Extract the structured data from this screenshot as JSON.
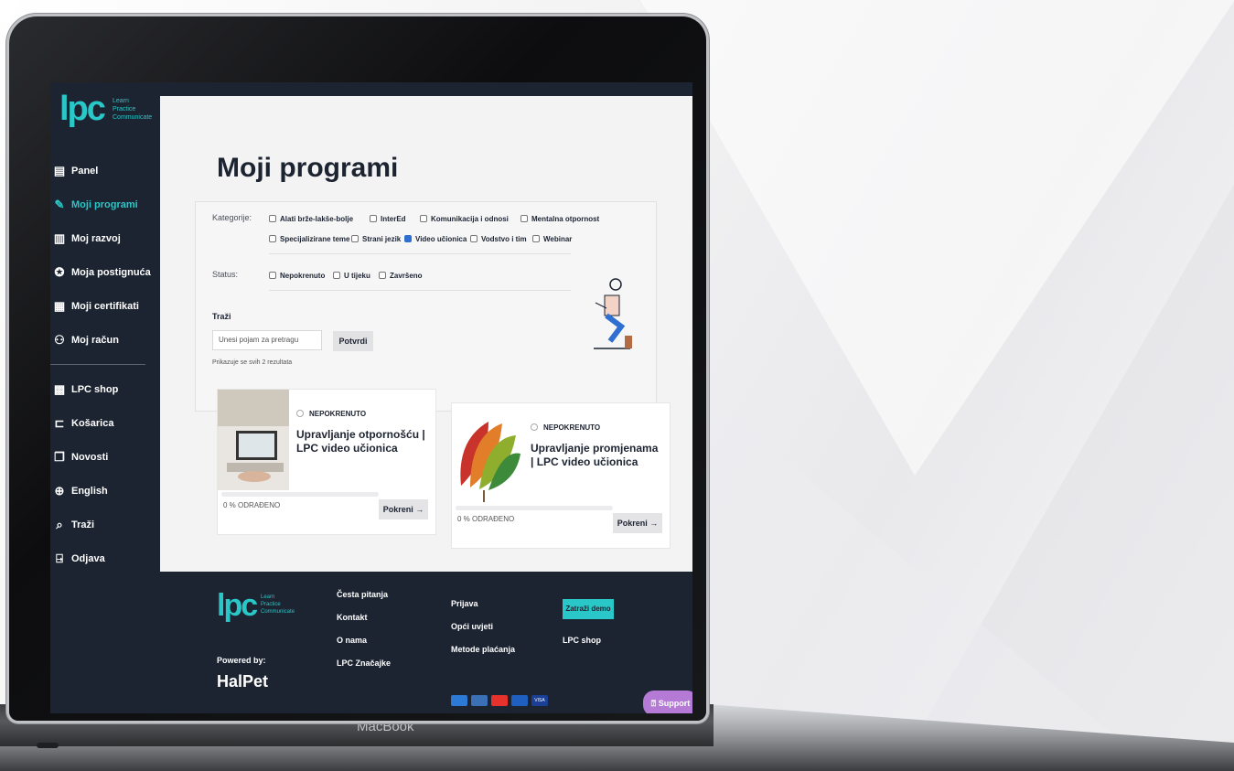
{
  "app": {
    "logo_mark": "lpc",
    "logo_tagline": [
      "Learn",
      "Practice",
      "Communicate"
    ]
  },
  "sidebar": {
    "items": [
      {
        "label": "Panel",
        "icon": "book-icon",
        "glyph": "▤"
      },
      {
        "label": "Moji programi",
        "icon": "edit-book-icon",
        "glyph": "✎"
      },
      {
        "label": "Moj razvoj",
        "icon": "document-icon",
        "glyph": "▥"
      },
      {
        "label": "Moja postignuća",
        "icon": "medal-icon",
        "glyph": "✪"
      },
      {
        "label": "Moji certifikati",
        "icon": "certificate-icon",
        "glyph": "▦"
      },
      {
        "label": "Moj račun",
        "icon": "user-icon",
        "glyph": "⚇"
      }
    ],
    "items2": [
      {
        "label": "LPC shop",
        "icon": "store-icon",
        "glyph": "▩"
      },
      {
        "label": "Košarica",
        "icon": "cart-icon",
        "glyph": "⊏"
      },
      {
        "label": "Novosti",
        "icon": "news-icon",
        "glyph": "❐"
      },
      {
        "label": "English",
        "icon": "globe-icon",
        "glyph": "⊕"
      },
      {
        "label": "Traži",
        "icon": "search-icon",
        "glyph": "⌕"
      },
      {
        "label": "Odjava",
        "icon": "logout-icon",
        "glyph": "⍈"
      }
    ],
    "active_index": 1
  },
  "main": {
    "title": "Moji programi",
    "filters": {
      "categories_label": "Kategorije:",
      "categories": [
        {
          "label": "Alati brže-lakše-bolje",
          "checked": false
        },
        {
          "label": "InterEd",
          "checked": false
        },
        {
          "label": "Komunikacija i odnosi",
          "checked": false
        },
        {
          "label": "Mentalna otpornost",
          "checked": false
        },
        {
          "label": "Specijalizirane teme",
          "checked": false
        },
        {
          "label": "Strani jezik",
          "checked": false
        },
        {
          "label": "Video učionica",
          "checked": true
        },
        {
          "label": "Vodstvo i tim",
          "checked": false
        },
        {
          "label": "Webinar",
          "checked": false
        }
      ],
      "status_label": "Status:",
      "statuses": [
        {
          "label": "Nepokrenuto",
          "checked": false
        },
        {
          "label": "U tijeku",
          "checked": false
        },
        {
          "label": "Završeno",
          "checked": false
        }
      ],
      "search_label": "Traži",
      "search_placeholder": "Unesi pojam za pretragu",
      "search_button": "Potvrdi",
      "results_text": "Prikazuje se svih 2 rezultata"
    },
    "cards": [
      {
        "status": "NEPOKRENUTO",
        "title": "Upravljanje otpornošću | LPC video učionica",
        "progress_text": "0 % ODRAĐENO",
        "progress": 0,
        "button": "Pokreni →"
      },
      {
        "status": "NEPOKRENUTO",
        "title": "Upravljanje promjenama | LPC video učionica",
        "progress_text": "0 % ODRAĐENO",
        "progress": 0,
        "button": "Pokreni →"
      }
    ]
  },
  "footer": {
    "powered_by": "Powered by:",
    "brand": "HalPet",
    "col1": [
      "Česta pitanja",
      "Kontakt",
      "O nama",
      "LPC Značajke"
    ],
    "col2": [
      "Prijava",
      "Opći uvjeti",
      "Metode plaćanja"
    ],
    "demo_button": "Zatraži demo",
    "shop_link": "LPC shop",
    "payments": [
      {
        "name": "amex-icon",
        "color": "#2c7ad6"
      },
      {
        "name": "maestro-card-icon",
        "color": "#3b6fb6"
      },
      {
        "name": "mastercard-icon",
        "color": "#e5322d"
      },
      {
        "name": "maestro-icon",
        "color": "#1f5fbf"
      },
      {
        "name": "visa-icon",
        "color": "#1a3f94",
        "text": "VISA"
      }
    ],
    "support": "Support"
  },
  "device": {
    "label": "MacBook"
  },
  "colors": {
    "accent": "#29c7c7",
    "navy": "#1c2331",
    "support": "#b57ad6"
  }
}
